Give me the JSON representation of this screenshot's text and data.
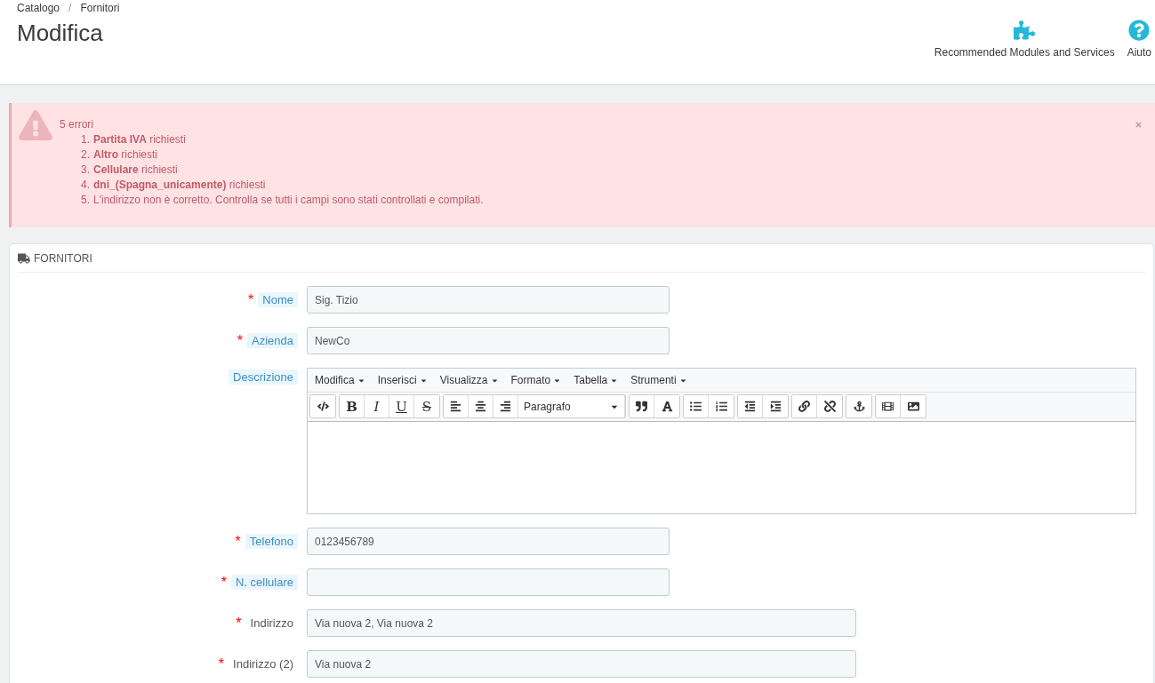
{
  "breadcrumb": [
    "Catalogo",
    "Fornitori"
  ],
  "breadcrumb_separator": "/",
  "page_title": "Modifica",
  "toolbar": [
    {
      "kind": "modules",
      "label": "Recommended Modules and Services"
    },
    {
      "kind": "help",
      "label": "Aiuto"
    }
  ],
  "alert": {
    "title": "5 errori",
    "items": [
      {
        "number": "1.",
        "text": "**Partita IVA** richiesti"
      },
      {
        "number": "2.",
        "text": "**Altro** richiesti"
      },
      {
        "number": "3.",
        "text": "**Cellulare** richiesti"
      },
      {
        "number": "4.",
        "text": "**dni_(Spagna_unicamente)** richiesti"
      },
      {
        "number": "5.",
        "text": "L'indirizzo non è corretto. Controlla se tutti i campi sono stati controllati e compilati."
      }
    ]
  },
  "panel": {
    "title": "FORNITORI",
    "fields": [
      {
        "kind": "input",
        "label": "Nome",
        "required_mark": "*",
        "hint": true,
        "wide": false,
        "value": "Sig. Tizio"
      },
      {
        "kind": "input",
        "label": "Azienda",
        "required_mark": "*",
        "hint": true,
        "wide": false,
        "value": "NewCo"
      },
      {
        "kind": "editor",
        "label": "Descrizione",
        "hint": true,
        "menus": [
          "Modifica",
          "Inserisci",
          "Visualizza",
          "Formato",
          "Tabella",
          "Strumenti"
        ],
        "format_buttons": [
          "B",
          "I",
          "U",
          "S"
        ],
        "block_format": "Paragrafo"
      },
      {
        "kind": "input",
        "label": "Telefono",
        "required_mark": "*",
        "hint": true,
        "wide": false,
        "value": "0123456789"
      },
      {
        "kind": "input",
        "label": "N. cellulare",
        "required_mark": "*",
        "hint": true,
        "wide": false
      },
      {
        "kind": "input",
        "label": "Indirizzo",
        "required_mark": "*",
        "hint": false,
        "wide": true,
        "value": "Via nuova 2, Via nuova 2"
      },
      {
        "kind": "input",
        "label": "Indirizzo (2)",
        "required_mark": "*",
        "hint": false,
        "wide": true,
        "value": "Via nuova 2"
      }
    ]
  }
}
